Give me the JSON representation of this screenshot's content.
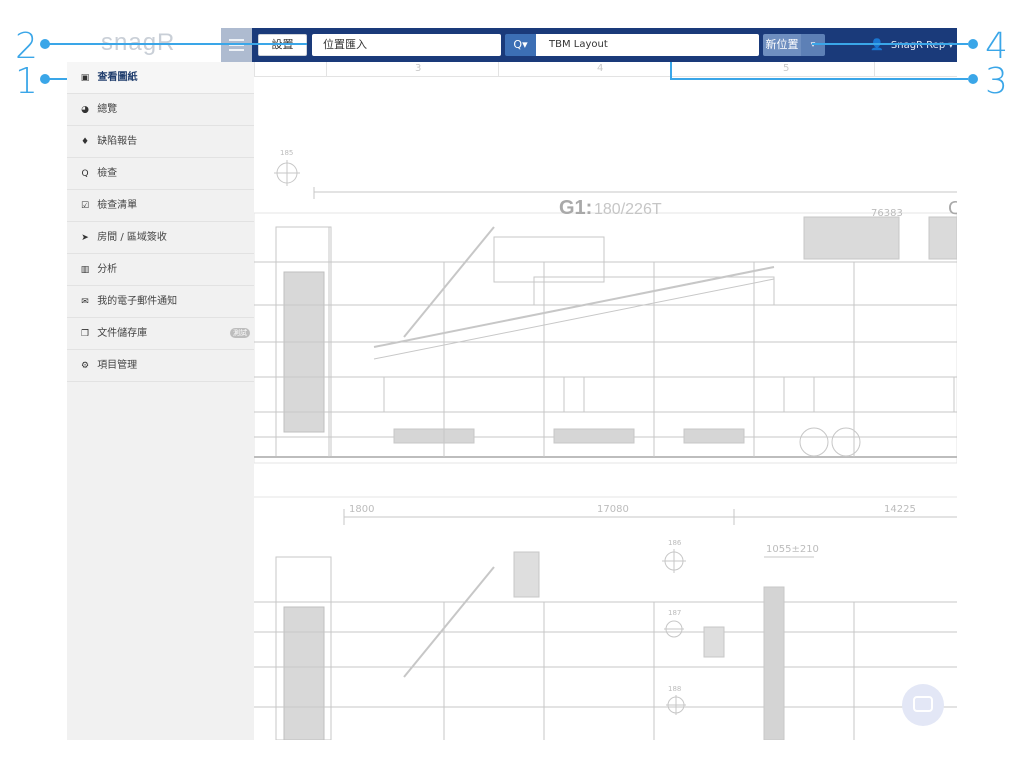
{
  "app": {
    "brand": "snagR",
    "settings_label": "設置",
    "import_label": "位置匯入",
    "search_caret": "Q▾",
    "layout_value": "TBM Layout",
    "new_location_label": "新位置",
    "user_name": "SnagR Rep ▾"
  },
  "ruler": {
    "labels": [
      "3",
      "4",
      "5"
    ]
  },
  "sidebar": {
    "items": [
      {
        "label": "查看圖紙",
        "icon": "image-icon"
      },
      {
        "label": "總覽",
        "icon": "dashboard-icon"
      },
      {
        "label": "缺陷報告",
        "icon": "map-pin-icon"
      },
      {
        "label": "檢查",
        "icon": "search-icon"
      },
      {
        "label": "檢查清單",
        "icon": "checklist-icon"
      },
      {
        "label": "房間 / 區域簽收",
        "icon": "location-arrow-icon"
      },
      {
        "label": "分析",
        "icon": "bar-chart-icon"
      },
      {
        "label": "我的電子郵件通知",
        "icon": "envelope-icon"
      },
      {
        "label": "文件儲存庫",
        "icon": "copy-icon",
        "badge": "測試"
      },
      {
        "label": "項目管理",
        "icon": "cogs-icon"
      }
    ]
  },
  "drawing": {
    "title": "G1:",
    "title_sub": "180/226T",
    "marker1": "185",
    "marker2": "186",
    "marker3": "187",
    "marker4": "188",
    "dim_top_right": "76383",
    "dim_right_letter": "C",
    "dim_mid_left": "1800",
    "dim_mid_center": "17080",
    "dim_mid_right": "14225",
    "dim_small": "1055±210"
  },
  "callouts": [
    "1",
    "2",
    "3",
    "4"
  ],
  "colors": {
    "topbar": "#1a3a7a",
    "accent": "#3c6fb5",
    "callout": "#3aa6e8",
    "drawing_line": "#c7c7c7"
  }
}
